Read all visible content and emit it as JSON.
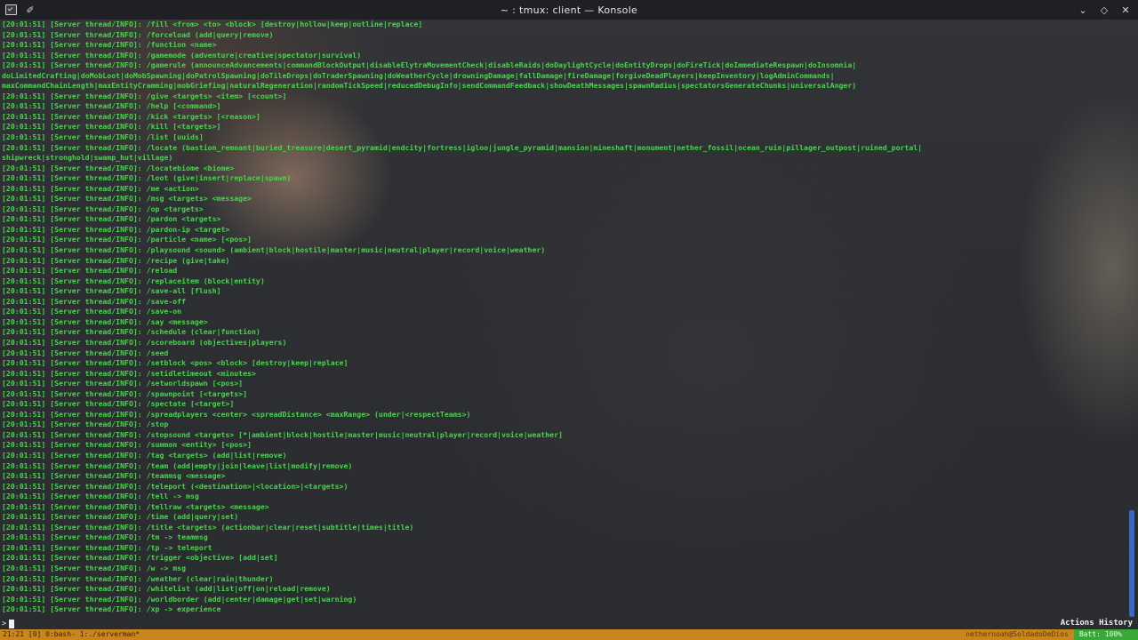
{
  "window": {
    "title": "~ : tmux: client — Konsole"
  },
  "titlebar_icons": {
    "left": [
      "konsole-app-icon",
      "pin-icon"
    ],
    "right": [
      "chevron-down-icon",
      "diamond-icon",
      "close-icon"
    ],
    "pin_glyph": "✐",
    "right_glyphs": [
      "⌄",
      "◇",
      "✕"
    ]
  },
  "colors": {
    "terminal_text": "#46d64a",
    "status_bar": "#c8861d",
    "battery_segment": "#3aa838",
    "scroll_thumb": "#3b6fd6"
  },
  "terminal": {
    "lines": [
      "[20:01:51] [Server thread/INFO]: /fill <from> <to> <block> [destroy|hollow|keep|outline|replace]",
      "[20:01:51] [Server thread/INFO]: /forceload (add|query|remove)",
      "[20:01:51] [Server thread/INFO]: /function <name>",
      "[20:01:51] [Server thread/INFO]: /gamemode (adventure|creative|spectator|survival)",
      "[20:01:51] [Server thread/INFO]: /gamerule (announceAdvancements|commandBlockOutput|disableElytraMovementCheck|disableRaids|doDaylightCycle|doEntityDrops|doFireTick|doImmediateRespawn|doInsomnia|",
      "doLimitedCrafting|doMobLoot|doMobSpawning|doPatrolSpawning|doTileDrops|doTraderSpawning|doWeatherCycle|drowningDamage|fallDamage|fireDamage|forgiveDeadPlayers|keepInventory|logAdminCommands|",
      "maxCommandChainLength|maxEntityCramming|mobGriefing|naturalRegeneration|randomTickSpeed|reducedDebugInfo|sendCommandFeedback|showDeathMessages|spawnRadius|spectatorsGenerateChunks|universalAnger)",
      "[20:01:51] [Server thread/INFO]: /give <targets> <item> [<count>]",
      "[20:01:51] [Server thread/INFO]: /help [<command>]",
      "[20:01:51] [Server thread/INFO]: /kick <targets> [<reason>]",
      "[20:01:51] [Server thread/INFO]: /kill [<targets>]",
      "[20:01:51] [Server thread/INFO]: /list [uuids]",
      "[20:01:51] [Server thread/INFO]: /locate (bastion_remnant|buried_treasure|desert_pyramid|endcity|fortress|igloo|jungle_pyramid|mansion|mineshaft|monument|nether_fossil|ocean_ruin|pillager_outpost|ruined_portal|",
      "shipwreck|stronghold|swamp_hut|village)",
      "[20:01:51] [Server thread/INFO]: /locatebiome <biome>",
      "[20:01:51] [Server thread/INFO]: /loot (give|insert|replace|spawn)",
      "[20:01:51] [Server thread/INFO]: /me <action>",
      "[20:01:51] [Server thread/INFO]: /msg <targets> <message>",
      "[20:01:51] [Server thread/INFO]: /op <targets>",
      "[20:01:51] [Server thread/INFO]: /pardon <targets>",
      "[20:01:51] [Server thread/INFO]: /pardon-ip <target>",
      "[20:01:51] [Server thread/INFO]: /particle <name> [<pos>]",
      "[20:01:51] [Server thread/INFO]: /playsound <sound> (ambient|block|hostile|master|music|neutral|player|record|voice|weather)",
      "[20:01:51] [Server thread/INFO]: /recipe (give|take)",
      "[20:01:51] [Server thread/INFO]: /reload",
      "[20:01:51] [Server thread/INFO]: /replaceitem (block|entity)",
      "[20:01:51] [Server thread/INFO]: /save-all [flush]",
      "[20:01:51] [Server thread/INFO]: /save-off",
      "[20:01:51] [Server thread/INFO]: /save-on",
      "[20:01:51] [Server thread/INFO]: /say <message>",
      "[20:01:51] [Server thread/INFO]: /schedule (clear|function)",
      "[20:01:51] [Server thread/INFO]: /scoreboard (objectives|players)",
      "[20:01:51] [Server thread/INFO]: /seed",
      "[20:01:51] [Server thread/INFO]: /setblock <pos> <block> [destroy|keep|replace]",
      "[20:01:51] [Server thread/INFO]: /setidletimeout <minutes>",
      "[20:01:51] [Server thread/INFO]: /setworldspawn [<pos>]",
      "[20:01:51] [Server thread/INFO]: /spawnpoint [<targets>]",
      "[20:01:51] [Server thread/INFO]: /spectate [<target>]",
      "[20:01:51] [Server thread/INFO]: /spreadplayers <center> <spreadDistance> <maxRange> (under|<respectTeams>)",
      "[20:01:51] [Server thread/INFO]: /stop",
      "[20:01:51] [Server thread/INFO]: /stopsound <targets> [*|ambient|block|hostile|master|music|neutral|player|record|voice|weather]",
      "[20:01:51] [Server thread/INFO]: /summon <entity> [<pos>]",
      "[20:01:51] [Server thread/INFO]: /tag <targets> (add|list|remove)",
      "[20:01:51] [Server thread/INFO]: /team (add|empty|join|leave|list|modify|remove)",
      "[20:01:51] [Server thread/INFO]: /teammsg <message>",
      "[20:01:51] [Server thread/INFO]: /teleport (<destination>|<location>|<targets>)",
      "[20:01:51] [Server thread/INFO]: /tell -> msg",
      "[20:01:51] [Server thread/INFO]: /tellraw <targets> <message>",
      "[20:01:51] [Server thread/INFO]: /time (add|query|set)",
      "[20:01:51] [Server thread/INFO]: /title <targets> (actionbar|clear|reset|subtitle|times|title)",
      "[20:01:51] [Server thread/INFO]: /tm -> teammsg",
      "[20:01:51] [Server thread/INFO]: /tp -> teleport",
      "[20:01:51] [Server thread/INFO]: /trigger <objective> [add|set]",
      "[20:01:51] [Server thread/INFO]: /w -> msg",
      "[20:01:51] [Server thread/INFO]: /weather (clear|rain|thunder)",
      "[20:01:51] [Server thread/INFO]: /whitelist (add|list|off|on|reload|remove)",
      "[20:01:51] [Server thread/INFO]: /worldborder (add|center|damage|get|set|warning)",
      "[20:01:51] [Server thread/INFO]: /xp -> experience"
    ],
    "prompt": ">",
    "actions_history": "Actions History"
  },
  "tmux_status": {
    "left": "21:21 [0] 0:bash- 1:./serverman*",
    "host": "nethernoah@SoldadoDeDios",
    "battery": "Batt: 100%"
  }
}
